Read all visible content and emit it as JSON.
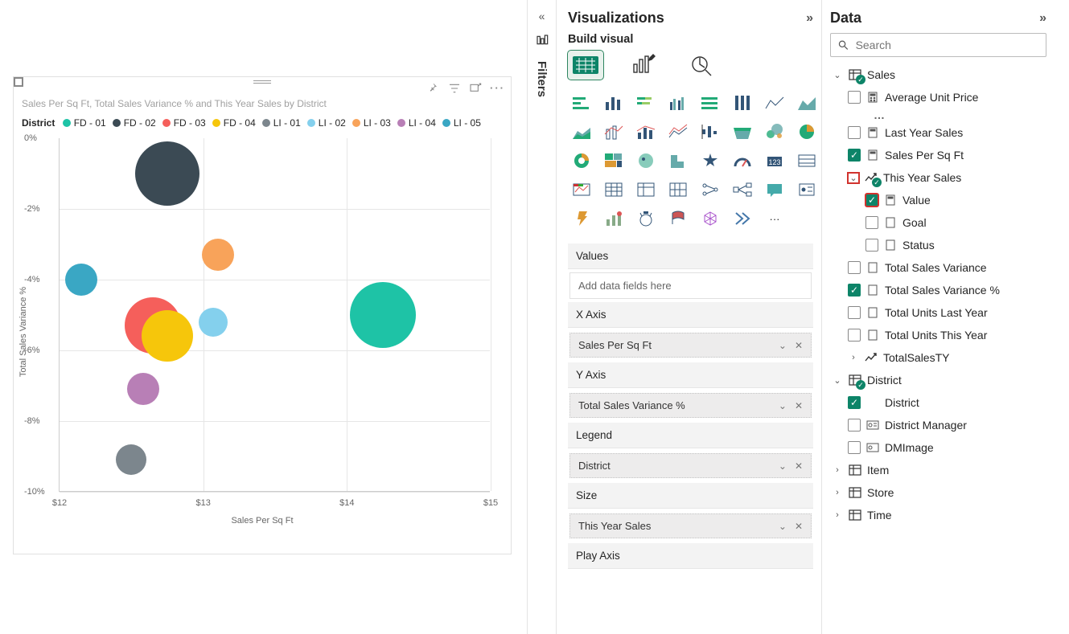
{
  "filters_label": "Filters",
  "visualizations": {
    "title": "Visualizations",
    "build_label": "Build visual",
    "wells": {
      "values_label": "Values",
      "values_placeholder": "Add data fields here",
      "x_axis_label": "X Axis",
      "x_axis_value": "Sales Per Sq Ft",
      "y_axis_label": "Y Axis",
      "y_axis_value": "Total Sales Variance %",
      "legend_label": "Legend",
      "legend_value": "District",
      "size_label": "Size",
      "size_value": "This Year Sales",
      "play_label": "Play Axis"
    }
  },
  "data_pane": {
    "title": "Data",
    "search_placeholder": "Search",
    "tables": {
      "sales": {
        "name": "Sales",
        "fields": {
          "avg_unit_price": "Average Unit Price",
          "last_year_sales": "Last Year Sales",
          "sales_per_sqft": "Sales Per Sq Ft",
          "this_year_sales": "This Year Sales",
          "tys_value": "Value",
          "tys_goal": "Goal",
          "tys_status": "Status",
          "total_sales_variance": "Total Sales Variance",
          "total_sales_variance_pct": "Total Sales Variance %",
          "total_units_last_year": "Total Units Last Year",
          "total_units_this_year": "Total Units This Year",
          "total_sales_ty": "TotalSalesTY"
        }
      },
      "district": {
        "name": "District",
        "fields": {
          "district": "District",
          "district_manager": "District Manager",
          "dm_image": "DMImage"
        }
      },
      "item": "Item",
      "store": "Store",
      "time": "Time"
    }
  },
  "chart": {
    "title": "Sales Per Sq Ft, Total Sales Variance % and This Year Sales by District",
    "legend_title": "District",
    "x_axis_title": "Sales Per Sq Ft",
    "y_axis_title": "Total Sales Variance %"
  },
  "chart_data": {
    "type": "scatter",
    "title": "Sales Per Sq Ft, Total Sales Variance % and This Year Sales by District",
    "xlabel": "Sales Per Sq Ft",
    "ylabel": "Total Sales Variance %",
    "xlim": [
      12,
      15
    ],
    "ylim": [
      -10,
      0
    ],
    "xticks": [
      "$12",
      "$13",
      "$14",
      "$15"
    ],
    "yticks": [
      "0%",
      "-2%",
      "-4%",
      "-6%",
      "-8%",
      "-10%"
    ],
    "size_field": "This Year Sales",
    "legend_field": "District",
    "series": [
      {
        "name": "FD - 01",
        "color": "#1EC3A6",
        "x": 14.25,
        "y": -5.0,
        "size": 82
      },
      {
        "name": "FD - 02",
        "color": "#3B4A54",
        "x": 12.75,
        "y": -1.0,
        "size": 80
      },
      {
        "name": "FD - 03",
        "color": "#F55F5B",
        "x": 12.65,
        "y": -5.3,
        "size": 70
      },
      {
        "name": "FD - 04",
        "color": "#F6C60B",
        "x": 12.75,
        "y": -5.6,
        "size": 64
      },
      {
        "name": "LI - 01",
        "color": "#7C868D",
        "x": 12.5,
        "y": -9.1,
        "size": 38
      },
      {
        "name": "LI - 02",
        "color": "#84D0ED",
        "x": 13.07,
        "y": -5.2,
        "size": 36
      },
      {
        "name": "LI - 03",
        "color": "#F8A35A",
        "x": 13.1,
        "y": -3.3,
        "size": 40
      },
      {
        "name": "LI - 04",
        "color": "#B87FB6",
        "x": 12.58,
        "y": -7.1,
        "size": 40
      },
      {
        "name": "LI - 05",
        "color": "#3AA7C4",
        "x": 12.15,
        "y": -4.0,
        "size": 40
      }
    ]
  }
}
